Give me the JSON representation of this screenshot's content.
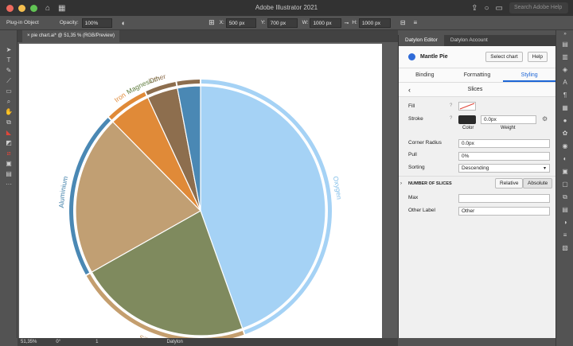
{
  "app": {
    "title": "Adobe Illustrator 2021",
    "help_placeholder": "Search Adobe Help"
  },
  "control_bar": {
    "object_type": "Plug-in Object",
    "opacity_label": "Opacity:",
    "opacity_value": "100%",
    "x_label": "X:",
    "x_value": "500 px",
    "y_label": "Y:",
    "y_value": "700 px",
    "w_label": "W:",
    "w_value": "1000 px",
    "h_label": "H:",
    "h_value": "1000 px"
  },
  "document": {
    "tab_label": "pie chart.ai* @ 51,35 % (RGB/Preview)"
  },
  "status_bar": {
    "zoom": "51,35%",
    "rotation": "0°",
    "artboard": "1",
    "plugin": "Datylon"
  },
  "panel": {
    "tabs": [
      "Datylon Editor",
      "Datylon Account"
    ],
    "chart_name": "Mantle Pie",
    "select_chart_label": "Select chart",
    "help_label": "Help",
    "subtabs": [
      "Binding",
      "Formatting",
      "Styling"
    ],
    "section_title": "Slices",
    "fill_label": "Fill",
    "stroke_label": "Stroke",
    "stroke_weight": "0.0px",
    "color_caption": "Color",
    "weight_caption": "Weight",
    "corner_radius_label": "Corner Radius",
    "corner_radius_value": "0.0px",
    "pull_label": "Pull",
    "pull_value": "0%",
    "sorting_label": "Sorting",
    "sorting_value": "Descending",
    "number_of_slices_label": "NUMBER OF SLICES",
    "relative_label": "Relative",
    "absolute_label": "Absolute",
    "max_label": "Max",
    "max_value": "",
    "other_label_label": "Other Label",
    "other_label_value": "Other"
  },
  "chart_data": {
    "type": "pie",
    "slices": [
      {
        "label": "Oxygen",
        "value": 45.0,
        "color": "#a5d2f5",
        "ring": "#a5d2f5"
      },
      {
        "label": "Silicon",
        "value": 22.5,
        "color": "#7f8a5e",
        "ring": "#c49e6e"
      },
      {
        "label": "Aluminium",
        "value": 21.0,
        "color": "#c19f73",
        "ring": "#4a88b4"
      },
      {
        "label": "Iron",
        "value": 5.5,
        "color": "#e08a38",
        "ring": "#e08a38"
      },
      {
        "label": "Magnesium",
        "value": 0.0,
        "color": "#5c8a4a",
        "ring": "#5c8a4a"
      },
      {
        "label": "Other",
        "value": 4.0,
        "color": "#8d6e4e",
        "ring": "#8d6e4e"
      },
      {
        "label": "",
        "value": 3.0,
        "color": "#4a88b4",
        "ring": "#8d6e4e"
      }
    ],
    "label_colors": {
      "Oxygen": "#7fbde8",
      "Silicon": "#c08e5a",
      "Aluminium": "#3d7ea8",
      "Iron": "#e08a38",
      "Magnesium": "#5c7a3a",
      "Other": "#8d6e4e"
    }
  }
}
